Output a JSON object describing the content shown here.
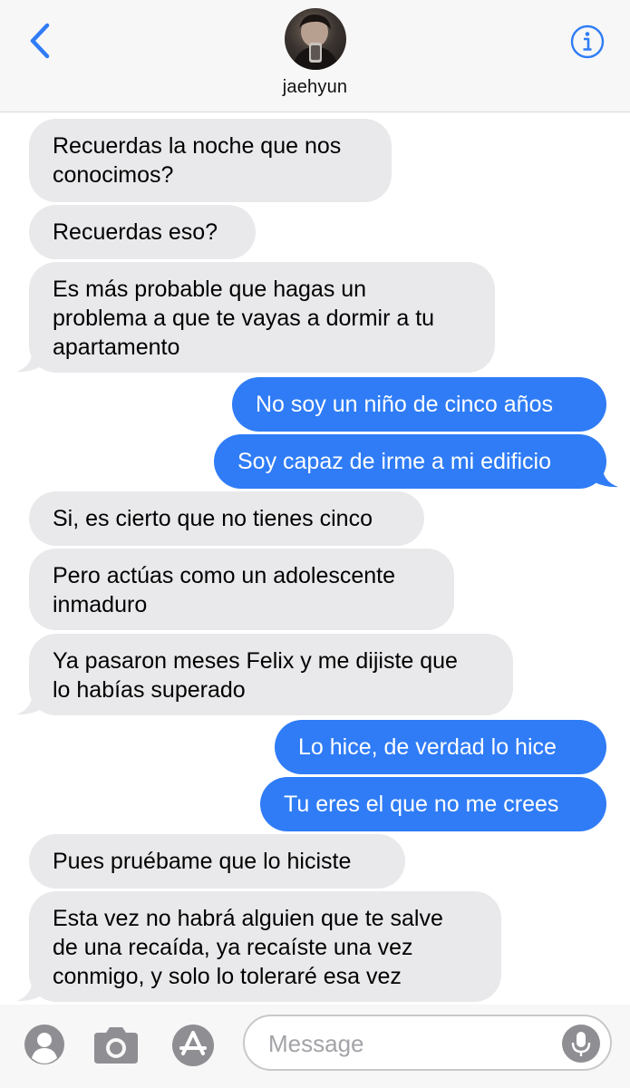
{
  "header": {
    "contact_name": "jaehyun",
    "back_icon": "chevron-left-icon",
    "info_icon": "info-icon",
    "accent_color": "#2f7cf6"
  },
  "messages": [
    {
      "side": "in",
      "lines": [
        "Recuerdas la noche que nos",
        "conocimos?"
      ]
    },
    {
      "side": "in",
      "lines": [
        "Recuerdas eso?"
      ]
    },
    {
      "side": "in",
      "lines": [
        "Es más probable que hagas un",
        "problema a que te vayas a dormir a tu",
        "apartamento"
      ]
    },
    {
      "side": "out",
      "lines": [
        "No soy un niño de cinco años"
      ]
    },
    {
      "side": "out",
      "lines": [
        "Soy capaz de irme a mi edificio"
      ]
    },
    {
      "side": "in",
      "lines": [
        "Si, es cierto que no tienes cinco"
      ]
    },
    {
      "side": "in",
      "lines": [
        "Pero actúas como un adolescente",
        "inmaduro"
      ]
    },
    {
      "side": "in",
      "lines": [
        "Ya pasaron meses Felix y me dijiste que",
        "lo habías superado"
      ]
    },
    {
      "side": "out",
      "lines": [
        "Lo hice, de verdad lo hice"
      ]
    },
    {
      "side": "out",
      "lines": [
        "Tu eres el que no me crees"
      ]
    },
    {
      "side": "in",
      "lines": [
        "Pues pruébame que lo hiciste"
      ]
    },
    {
      "side": "in",
      "lines": [
        "Esta vez no habrá alguien que te salve",
        "de una recaída, ya recaíste una vez",
        "conmigo, y solo lo toleraré esa vez"
      ]
    }
  ],
  "composer": {
    "placeholder": "Message",
    "icons": [
      "contact-icon",
      "camera-icon",
      "app-store-icon",
      "microphone-icon"
    ]
  }
}
